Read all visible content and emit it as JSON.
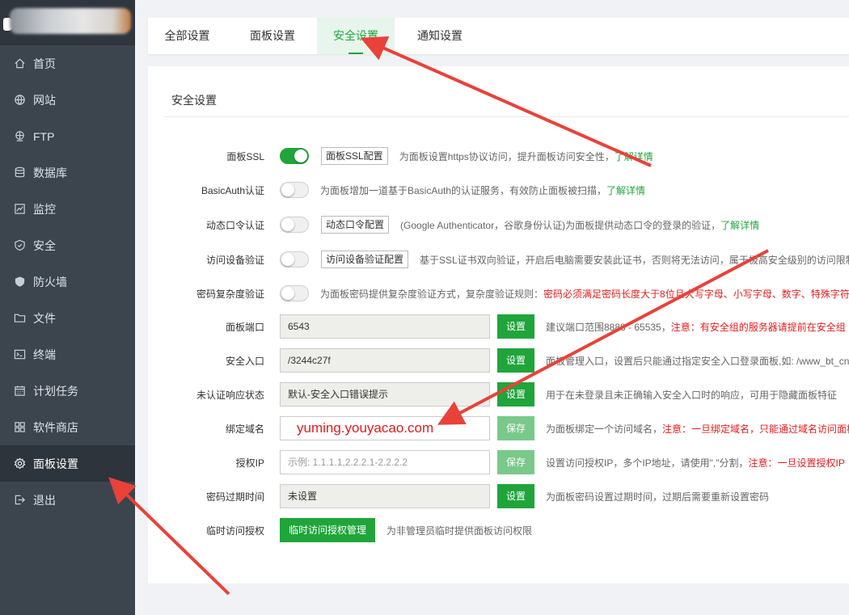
{
  "sidebar": {
    "items": [
      {
        "label": "首页",
        "icon": "home-icon"
      },
      {
        "label": "网站",
        "icon": "globe-icon"
      },
      {
        "label": "FTP",
        "icon": "ftp-icon"
      },
      {
        "label": "数据库",
        "icon": "database-icon"
      },
      {
        "label": "监控",
        "icon": "monitor-icon"
      },
      {
        "label": "安全",
        "icon": "shield-icon"
      },
      {
        "label": "防火墙",
        "icon": "firewall-icon"
      },
      {
        "label": "文件",
        "icon": "folder-icon"
      },
      {
        "label": "终端",
        "icon": "terminal-icon"
      },
      {
        "label": "计划任务",
        "icon": "calendar-icon"
      },
      {
        "label": "软件商店",
        "icon": "grid-icon"
      },
      {
        "label": "面板设置",
        "icon": "gear-icon"
      },
      {
        "label": "退出",
        "icon": "logout-icon"
      }
    ],
    "active_index": 11
  },
  "tabs": [
    {
      "label": "全部设置"
    },
    {
      "label": "面板设置"
    },
    {
      "label": "安全设置"
    },
    {
      "label": "通知设置"
    }
  ],
  "panel": {
    "title": "安全设置",
    "ssl": {
      "label": "面板SSL",
      "button": "面板SSL配置",
      "desc": "为面板设置https协议访问，提升面板访问安全性，",
      "link": "了解详情"
    },
    "basicauth": {
      "label": "BasicAuth认证",
      "desc": "为面板增加一道基于BasicAuth的认证服务，有效防止面板被扫描，",
      "link": "了解详情"
    },
    "otp": {
      "label": "动态口令认证",
      "button": "动态口令配置",
      "desc": "(Google Authenticator，谷歌身份认证)为面板提供动态口令的登录的验证，",
      "link": "了解详情"
    },
    "device": {
      "label": "访问设备验证",
      "button": "访问设备验证配置",
      "desc": "基于SSL证书双向验证，开启后电脑需要安装此证书，否则将无法访问，属于极高安全级别的访问限制"
    },
    "pwdcomplex": {
      "label": "密码复杂度验证",
      "desc": "为面板密码提供复杂度验证方式，复杂度验证规则：",
      "red": "密码必须满足密码长度大于8位且大写字母、小写字母、数字、特殊字符"
    },
    "port": {
      "label": "面板端口",
      "value": "6543",
      "button": "设置",
      "desc": "建议端口范围8888 - 65535，",
      "red": "注意：有安全组的服务器请提前在安全组"
    },
    "entry": {
      "label": "安全入口",
      "value": "/3244c27f",
      "button": "设置",
      "desc": "面板管理入口，设置后只能通过指定安全入口登录面板,如: /www_bt_cn"
    },
    "unauth": {
      "label": "未认证响应状态",
      "value": "默认-安全入口错误提示",
      "button": "设置",
      "desc": "用于在未登录且未正确输入安全入口时的响应，可用于隐藏面板特征"
    },
    "domain": {
      "label": "绑定域名",
      "value": "yuming.youyacao.com",
      "button": "保存",
      "desc": "为面板绑定一个访问域名，",
      "red": "注意：一旦绑定域名，只能通过域名访问面板"
    },
    "ip": {
      "label": "授权IP",
      "placeholder": "示例: 1.1.1.1,2.2.2.1-2.2.2.2",
      "button": "保存",
      "desc": "设置访问授权IP，多个IP地址，请使用\",\"分割，",
      "red": "注意：一旦设置授权IP"
    },
    "expire": {
      "label": "密码过期时间",
      "value": "未设置",
      "button": "设置",
      "desc": "为面板密码设置过期时间，过期后需要重新设置密码"
    },
    "temp": {
      "label": "临时访问授权",
      "button": "临时访问授权管理",
      "desc": "为非管理员临时提供面板访问权限"
    }
  },
  "colors": {
    "accent": "#20a53a",
    "warning": "#e41c1c",
    "sidebar": "#3c444d",
    "annotation_arrow": "#e8423a"
  }
}
